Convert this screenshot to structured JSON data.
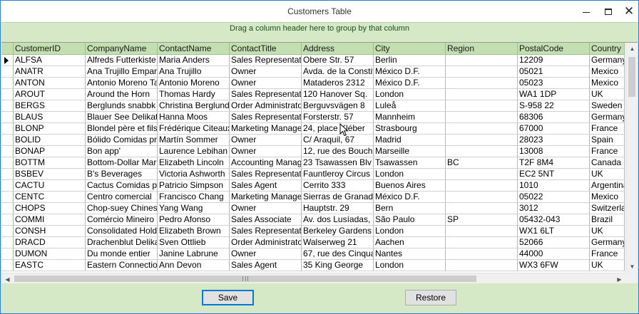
{
  "window": {
    "title": "Customers Table",
    "controls": {
      "minimize": "minimize",
      "maximize": "maximize",
      "close": "✕"
    }
  },
  "group_panel": {
    "text": "Drag a column header here to group by that column"
  },
  "grid": {
    "columns": [
      "CustomerID",
      "CompanyName",
      "ContactName",
      "ContactTitle",
      "Address",
      "City",
      "Region",
      "PostalCode",
      "Country"
    ],
    "rows": [
      [
        "ALFSA",
        "Alfreds Futterkiste",
        "Maria Anders",
        "Sales Representati",
        "Obere Str. 57",
        "Berlin",
        "",
        "12209",
        "Germany"
      ],
      [
        "ANATR",
        "Ana Trujillo Empar",
        "Ana Trujillo",
        "Owner",
        "Avda. de la Constit",
        "México D.F.",
        "",
        "05021",
        "Mexico"
      ],
      [
        "ANTON",
        "Antonio Moreno Ta",
        "Antonio Moreno",
        "Owner",
        "Mataderos  2312",
        "México D.F.",
        "",
        "05023",
        "Mexico"
      ],
      [
        "AROUT",
        "Around the Horn",
        "Thomas Hardy",
        "Sales Representati",
        "120 Hanover Sq.",
        "London",
        "",
        "WA1 1DP",
        "UK"
      ],
      [
        "BERGS",
        "Berglunds snabbk",
        "Christina Berglund",
        "Order Administrato",
        "Berguvsvägen  8",
        "Luleå",
        "",
        "S-958 22",
        "Sweden"
      ],
      [
        "BLAUS",
        "Blauer See Delikat",
        "Hanna Moos",
        "Sales Representati",
        "Forsterstr. 57",
        "Mannheim",
        "",
        "68306",
        "Germany"
      ],
      [
        "BLONP",
        "Blondel père et fils",
        "Frédérique Citeaux",
        "Marketing Manage",
        "24, place Kléber",
        "Strasbourg",
        "",
        "67000",
        "France"
      ],
      [
        "BOLID",
        "Bólido Comidas pr",
        "Martín Sommer",
        "Owner",
        "C/ Araquil, 67",
        "Madrid",
        "",
        "28023",
        "Spain"
      ],
      [
        "BONAP",
        "Bon app'",
        "Laurence Lebihan",
        "Owner",
        "12, rue des Bouch",
        "Marseille",
        "",
        "13008",
        "France"
      ],
      [
        "BOTTM",
        "Bottom-Dollar Mar",
        "Elizabeth Lincoln",
        "Accounting Manag",
        "23 Tsawassen Blv",
        "Tsawassen",
        "BC",
        "T2F 8M4",
        "Canada"
      ],
      [
        "BSBEV",
        "B's Beverages",
        "Victoria Ashworth",
        "Sales Representati",
        "Fauntleroy Circus",
        "London",
        "",
        "EC2 5NT",
        "UK"
      ],
      [
        "CACTU",
        "Cactus Comidas p",
        "Patricio Simpson",
        "Sales Agent",
        "Cerrito 333",
        "Buenos Aires",
        "",
        "1010",
        "Argentina"
      ],
      [
        "CENTC",
        "Centro comercial",
        "Francisco Chang",
        "Marketing Manage",
        "Sierras de Granad",
        "México D.F.",
        "",
        "05022",
        "Mexico"
      ],
      [
        "CHOPS",
        "Chop-suey Chines",
        "Yang Wang",
        "Owner",
        "Hauptstr. 29",
        "Bern",
        "",
        "3012",
        "Switzerlar"
      ],
      [
        "COMMI",
        "Comércio Mineiro",
        "Pedro Afonso",
        "Sales Associate",
        "Av. dos Lusíadas,",
        "São Paulo",
        "SP",
        "05432-043",
        "Brazil"
      ],
      [
        "CONSH",
        "Consolidated Holdi",
        "Elizabeth Brown",
        "Sales Representati",
        "Berkeley Gardens",
        "London",
        "",
        "WX1 6LT",
        "UK"
      ],
      [
        "DRACD",
        "Drachenblut Delika",
        "Sven Ottlieb",
        "Order Administrato",
        "Walserweg 21",
        "Aachen",
        "",
        "52066",
        "Germany"
      ],
      [
        "DUMON",
        "Du monde entier",
        "Janine Labrune",
        "Owner",
        "67, rue des Cinqua",
        "Nantes",
        "",
        "44000",
        "France"
      ],
      [
        "EASTC",
        "Eastern Connectio",
        "Ann Devon",
        "Sales Agent",
        "35 King George",
        "London",
        "",
        "WX3 6FW",
        "UK"
      ]
    ]
  },
  "scrollbars": {
    "up": "▲",
    "down": "▼",
    "left": "◀",
    "right": "▶"
  },
  "buttons": {
    "save": "Save",
    "restore": "Restore"
  },
  "colors": {
    "background": "#d6e9c6",
    "header": "#c3deb1",
    "accent": "#0078d7"
  }
}
